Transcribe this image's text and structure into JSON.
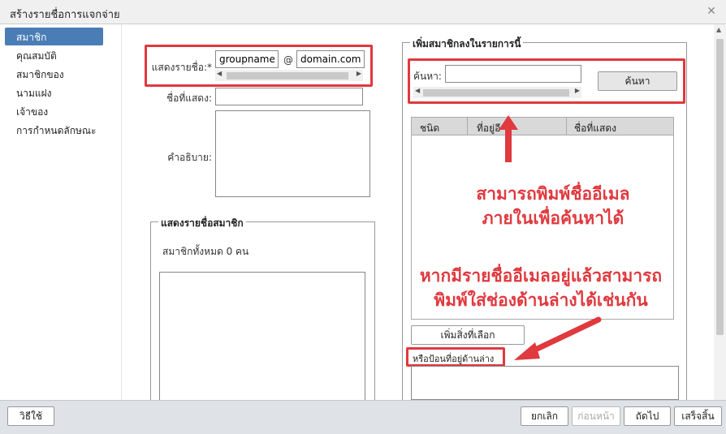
{
  "window": {
    "title": "สร้างรายชื่อการแจกจ่าย",
    "close_icon": "close-icon"
  },
  "sidebar": {
    "items": [
      {
        "label": "สมาชิก"
      },
      {
        "label": "คุณสมบัติ"
      },
      {
        "label": "สมาชิกของ"
      },
      {
        "label": "นามแฝง"
      },
      {
        "label": "เจ้าของ"
      },
      {
        "label": "การกำหนดลักษณะ"
      }
    ]
  },
  "form": {
    "display_list_label": "แสดงรายชื่อ:*",
    "username_value": "groupname",
    "at_sign": "@",
    "domain_value": "domain.com",
    "display_name_label": "ชื่อที่แสดง:",
    "display_name_value": "",
    "description_label": "คำอธิบาย:"
  },
  "members_section": {
    "legend": "แสดงรายชื่อสมาชิก",
    "count_text": "สมาชิกทั้งหมด 0 คน"
  },
  "add_section": {
    "legend": "เพิ่มสมาชิกลงในรายการนี้",
    "search_label": "ค้นหา:",
    "search_value": "",
    "search_button": "ค้นหา",
    "columns": [
      "ชนิด",
      "ที่อยู่อี",
      "ชื่อที่แสดง"
    ],
    "add_selected_button": "เพิ่มสิ่งที่เลือก",
    "or_enter_label": "หรือป้อนที่อยู่ด้านล่าง"
  },
  "annotations": {
    "note1_line1": "สามารถพิมพ์ชื่ออีเมล",
    "note1_line2": "ภายในเพื่อค้นหาได้",
    "note2_line1": "หากมีรายชื่ออีเมลอยู่แล้วสามารถ",
    "note2_line2": "พิมพ์ใส่ช่องด้านล่างได้เช่นกัน"
  },
  "footer": {
    "help_button": "วิธีใช้",
    "cancel_button": "ยกเลิก",
    "back_button": "ก่อนหน้า",
    "next_button": "ถัดไป",
    "finish_button": "เสร็จสิ้น"
  },
  "colors": {
    "accent": "#4a7db5",
    "annotation": "#e0393e"
  }
}
